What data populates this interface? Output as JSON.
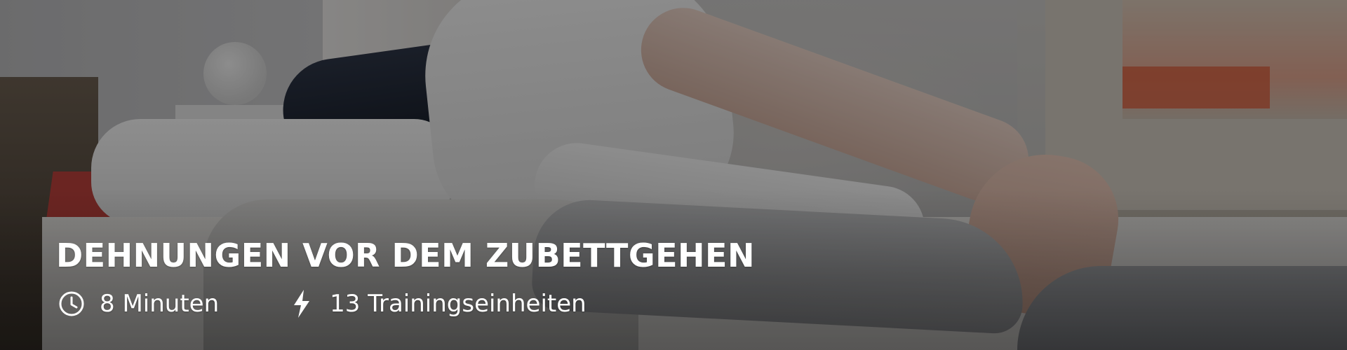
{
  "hero": {
    "title": "DEHNUNGEN VOR DEM ZUBETTGEHEN",
    "meta": [
      {
        "icon": "clock-icon",
        "text": "8 Minuten"
      },
      {
        "icon": "lightning-icon",
        "text": "13 Trainingseinheiten"
      }
    ]
  }
}
